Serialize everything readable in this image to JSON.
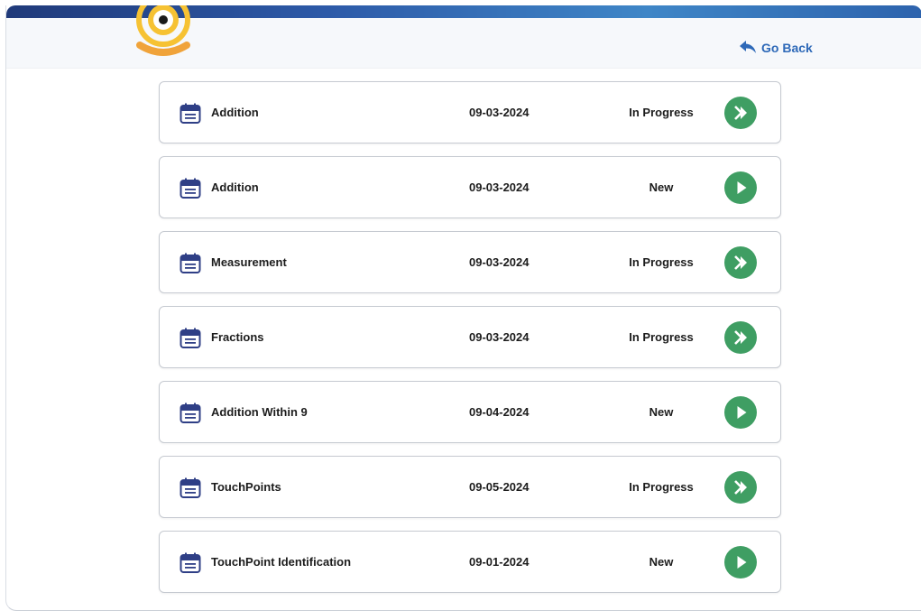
{
  "header": {
    "go_back_label": "Go Back"
  },
  "colors": {
    "top_bar": "#2d5aa8",
    "go_back": "#2e69b8",
    "play_button": "#3f9e63",
    "calendar_icon": "#2f3f86",
    "logo_orange": "#f0a33a",
    "logo_yellow": "#f6c233"
  },
  "rows": [
    {
      "name": "Addition",
      "date": "09-03-2024",
      "status": "In Progress",
      "action_icon": "resume-icon"
    },
    {
      "name": "Addition",
      "date": "09-03-2024",
      "status": "New",
      "action_icon": "play-icon"
    },
    {
      "name": "Measurement",
      "date": "09-03-2024",
      "status": "In Progress",
      "action_icon": "resume-icon"
    },
    {
      "name": "Fractions",
      "date": "09-03-2024",
      "status": "In Progress",
      "action_icon": "resume-icon"
    },
    {
      "name": "Addition Within 9",
      "date": "09-04-2024",
      "status": "New",
      "action_icon": "play-icon"
    },
    {
      "name": "TouchPoints",
      "date": "09-05-2024",
      "status": "In Progress",
      "action_icon": "resume-icon"
    },
    {
      "name": "TouchPoint Identification",
      "date": "09-01-2024",
      "status": "New",
      "action_icon": "play-icon"
    }
  ]
}
